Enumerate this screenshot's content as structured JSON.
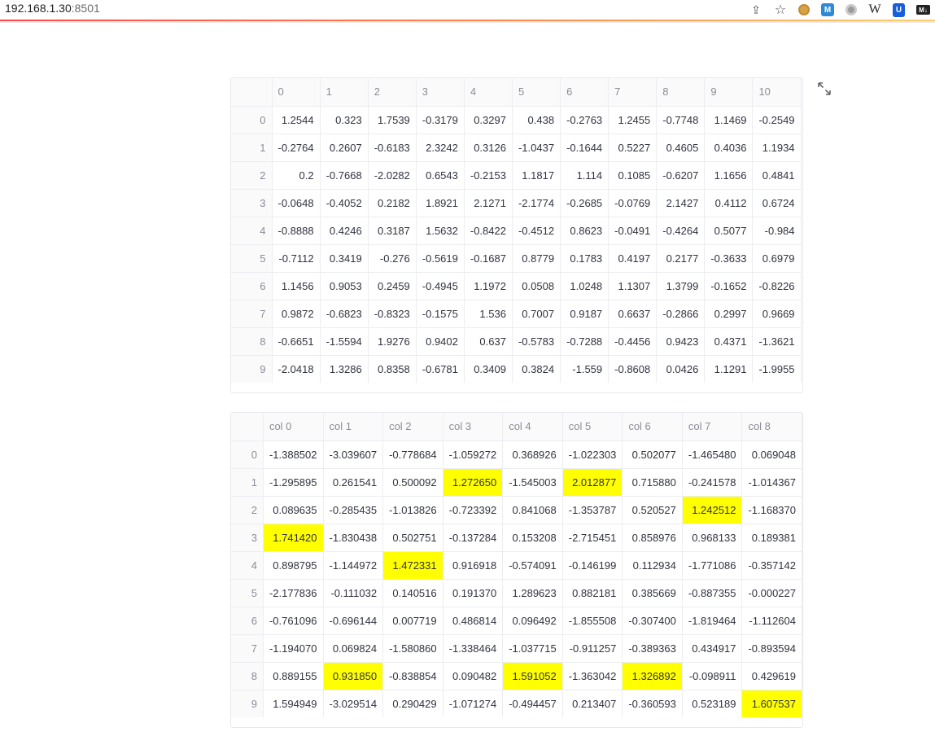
{
  "browser": {
    "url_host": "192.168.1.30",
    "url_port": ":8501"
  },
  "table1": {
    "columns": [
      "0",
      "1",
      "2",
      "3",
      "4",
      "5",
      "6",
      "7",
      "8",
      "9",
      "10"
    ],
    "rows": [
      {
        "index": "0",
        "values": [
          "1.2544",
          "0.323",
          "1.7539",
          "-0.3179",
          "0.3297",
          "0.438",
          "-0.2763",
          "1.2455",
          "-0.7748",
          "1.1469",
          "-0.2549"
        ]
      },
      {
        "index": "1",
        "values": [
          "-0.2764",
          "0.2607",
          "-0.6183",
          "2.3242",
          "0.3126",
          "-1.0437",
          "-0.1644",
          "0.5227",
          "0.4605",
          "0.4036",
          "1.1934"
        ]
      },
      {
        "index": "2",
        "values": [
          "0.2",
          "-0.7668",
          "-2.0282",
          "0.6543",
          "-0.2153",
          "1.1817",
          "1.114",
          "0.1085",
          "-0.6207",
          "1.1656",
          "0.4841"
        ]
      },
      {
        "index": "3",
        "values": [
          "-0.0648",
          "-0.4052",
          "0.2182",
          "1.8921",
          "2.1271",
          "-2.1774",
          "-0.2685",
          "-0.0769",
          "2.1427",
          "0.4112",
          "0.6724"
        ]
      },
      {
        "index": "4",
        "values": [
          "-0.8888",
          "0.4246",
          "0.3187",
          "1.5632",
          "-0.8422",
          "-0.4512",
          "0.8623",
          "-0.0491",
          "-0.4264",
          "0.5077",
          "-0.984"
        ]
      },
      {
        "index": "5",
        "values": [
          "-0.7112",
          "0.3419",
          "-0.276",
          "-0.5619",
          "-0.1687",
          "0.8779",
          "0.1783",
          "0.4197",
          "0.2177",
          "-0.3633",
          "0.6979"
        ]
      },
      {
        "index": "6",
        "values": [
          "1.1456",
          "0.9053",
          "0.2459",
          "-0.4945",
          "1.1972",
          "0.0508",
          "1.0248",
          "1.1307",
          "1.3799",
          "-0.1652",
          "-0.8226"
        ]
      },
      {
        "index": "7",
        "values": [
          "0.9872",
          "-0.6823",
          "-0.8323",
          "-0.1575",
          "1.536",
          "0.7007",
          "0.9187",
          "0.6637",
          "-0.2866",
          "0.2997",
          "0.9669"
        ]
      },
      {
        "index": "8",
        "values": [
          "-0.6651",
          "-1.5594",
          "1.9276",
          "0.9402",
          "0.637",
          "-0.5783",
          "-0.7288",
          "-0.4456",
          "0.9423",
          "0.4371",
          "-1.3621"
        ]
      },
      {
        "index": "9",
        "values": [
          "-2.0418",
          "1.3286",
          "0.8358",
          "-0.6781",
          "0.3409",
          "0.3824",
          "-1.559",
          "-0.8608",
          "0.0426",
          "1.1291",
          "-1.9955"
        ]
      }
    ]
  },
  "table2": {
    "highlight_color": "#ffff00",
    "columns": [
      "col 0",
      "col 1",
      "col 2",
      "col 3",
      "col 4",
      "col 5",
      "col 6",
      "col 7",
      "col 8"
    ],
    "rows": [
      {
        "index": "0",
        "values": [
          "-1.388502",
          "-3.039607",
          "-0.778684",
          "-1.059272",
          "0.368926",
          "-1.022303",
          "0.502077",
          "-1.465480",
          "0.069048"
        ],
        "highlight": []
      },
      {
        "index": "1",
        "values": [
          "-1.295895",
          "0.261541",
          "0.500092",
          "1.272650",
          "-1.545003",
          "2.012877",
          "0.715880",
          "-0.241578",
          "-1.014367"
        ],
        "highlight": [
          3,
          5
        ]
      },
      {
        "index": "2",
        "values": [
          "0.089635",
          "-0.285435",
          "-1.013826",
          "-0.723392",
          "0.841068",
          "-1.353787",
          "0.520527",
          "1.242512",
          "-1.168370"
        ],
        "highlight": [
          7
        ]
      },
      {
        "index": "3",
        "values": [
          "1.741420",
          "-1.830438",
          "0.502751",
          "-0.137284",
          "0.153208",
          "-2.715451",
          "0.858976",
          "0.968133",
          "0.189381"
        ],
        "highlight": [
          0
        ]
      },
      {
        "index": "4",
        "values": [
          "0.898795",
          "-1.144972",
          "1.472331",
          "0.916918",
          "-0.574091",
          "-0.146199",
          "0.112934",
          "-1.771086",
          "-0.357142"
        ],
        "highlight": [
          2
        ]
      },
      {
        "index": "5",
        "values": [
          "-2.177836",
          "-0.111032",
          "0.140516",
          "0.191370",
          "1.289623",
          "0.882181",
          "0.385669",
          "-0.887355",
          "-0.000227"
        ],
        "highlight": []
      },
      {
        "index": "6",
        "values": [
          "-0.761096",
          "-0.696144",
          "0.007719",
          "0.486814",
          "0.096492",
          "-1.855508",
          "-0.307400",
          "-1.819464",
          "-1.112604"
        ],
        "highlight": []
      },
      {
        "index": "7",
        "values": [
          "-1.194070",
          "0.069824",
          "-1.580860",
          "-1.338464",
          "-1.037715",
          "-0.911257",
          "-0.389363",
          "0.434917",
          "-0.893594"
        ],
        "highlight": []
      },
      {
        "index": "8",
        "values": [
          "0.889155",
          "0.931850",
          "-0.838854",
          "0.090482",
          "1.591052",
          "-1.363042",
          "1.326892",
          "-0.098911",
          "0.429619"
        ],
        "highlight": [
          1,
          4,
          6
        ]
      },
      {
        "index": "9",
        "values": [
          "1.594949",
          "-3.029514",
          "0.290429",
          "-1.071274",
          "-0.494457",
          "0.213407",
          "-0.360593",
          "0.523189",
          "1.607537"
        ],
        "highlight": [
          8
        ]
      }
    ]
  }
}
